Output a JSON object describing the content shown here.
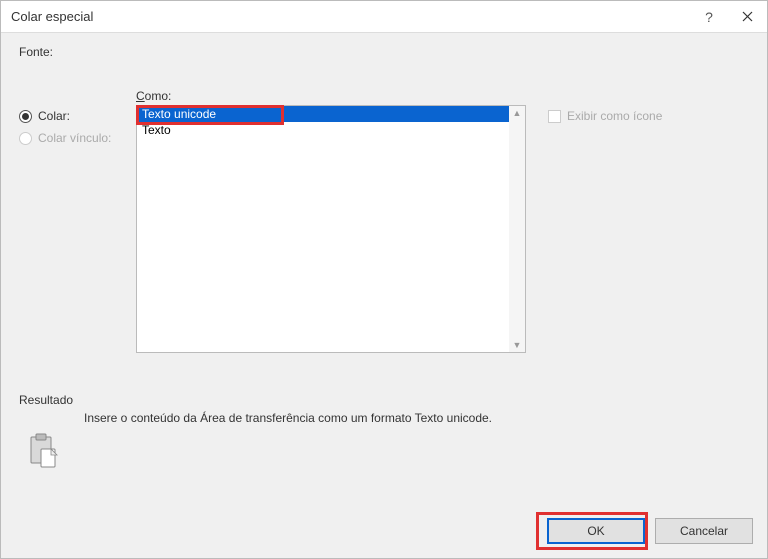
{
  "titlebar": {
    "title": "Colar especial"
  },
  "labels": {
    "fonte": "Fonte:",
    "como_prefix": "C",
    "como_rest": "omo:",
    "resultado": "Resultado"
  },
  "radios": {
    "colar": "Colar:",
    "colar_vinculo": "Colar vínculo:"
  },
  "list": {
    "items": [
      "Texto unicode",
      "Texto"
    ],
    "selected_index": 0
  },
  "checkbox": {
    "exibir_icone": "Exibir como ícone"
  },
  "result_text": "Insere o conteúdo da Área de transferência como um formato Texto unicode.",
  "buttons": {
    "ok": "OK",
    "cancel": "Cancelar"
  }
}
